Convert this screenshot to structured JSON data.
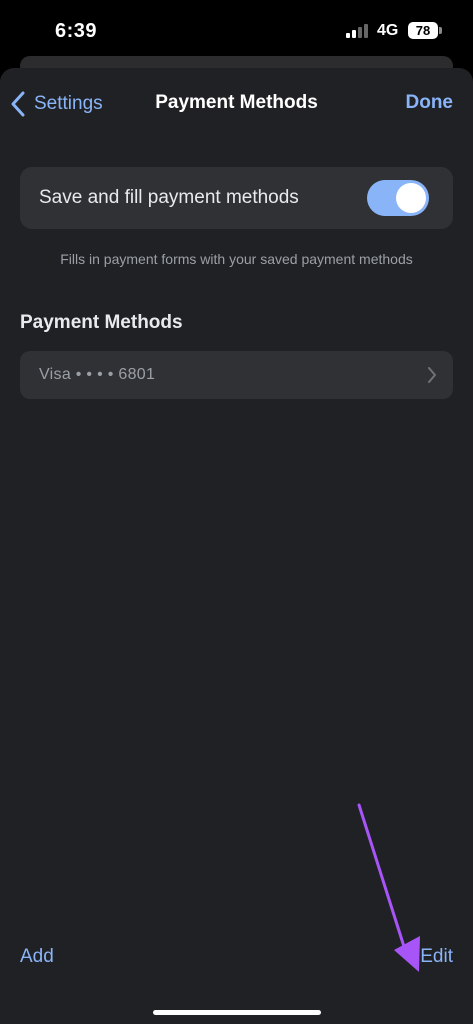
{
  "status_bar": {
    "time": "6:39",
    "network": "4G",
    "battery": "78"
  },
  "nav": {
    "back_label": "Settings",
    "title": "Payment Methods",
    "done_label": "Done"
  },
  "autofill": {
    "label": "Save and fill payment methods",
    "enabled": true,
    "caption": "Fills in payment forms with your saved payment methods"
  },
  "payment_methods": {
    "section_title": "Payment Methods",
    "items": [
      {
        "label": "Visa  • • • • 6801"
      }
    ]
  },
  "toolbar": {
    "add_label": "Add",
    "edit_label": "Edit"
  },
  "colors": {
    "accent": "#8ab4f8",
    "sheet_background": "#202124",
    "card_background": "#303134",
    "annotation_arrow": "#a855f7"
  },
  "icons": {
    "back": "chevron-left-icon",
    "row_disclosure": "chevron-right-icon",
    "annotation": "arrow-icon"
  }
}
